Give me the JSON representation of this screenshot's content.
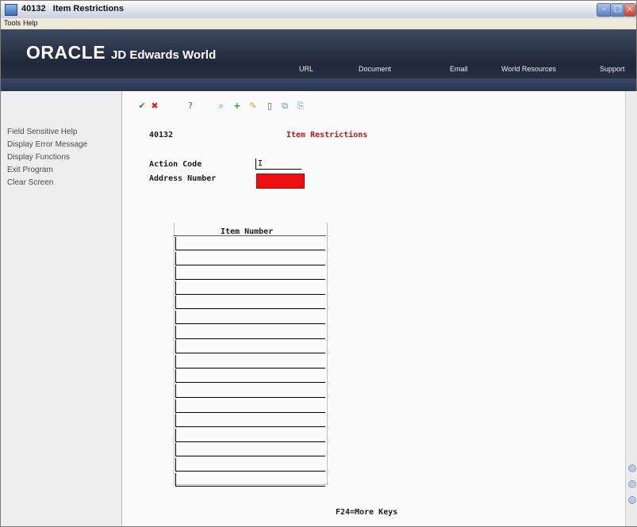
{
  "window": {
    "title": "40132   Item Restrictions",
    "menu": [
      "Tools",
      "Help"
    ]
  },
  "banner": {
    "brand": "ORACLE",
    "brand_sub": "JD Edwards World",
    "links": [
      "URL",
      "Document",
      "Email",
      "World Resources",
      "Support"
    ]
  },
  "sidebar": {
    "items": [
      {
        "label": "Field Sensitive Help"
      },
      {
        "label": "Display Error Message"
      },
      {
        "label": "Display Functions"
      },
      {
        "label": "Exit Program"
      },
      {
        "label": "Clear Screen"
      }
    ]
  },
  "toolbar": {
    "icons": [
      "ok-check-icon",
      "cancel-icon",
      "help-question-icon",
      "find-icon",
      "add-icon",
      "edit-pencil-icon",
      "delete-icon",
      "copy-icon",
      "paste-icon"
    ],
    "colors": {
      "ok": "#2f8f2f",
      "cancel": "#c62828",
      "add": "#2f9a2f",
      "edit": "#d7a000"
    }
  },
  "form": {
    "program_id": "40132",
    "title": "Item Restrictions",
    "action_code_label": "Action Code",
    "action_code_value": "I",
    "address_number_label": "Address Number",
    "address_number_value": "",
    "grid": {
      "column_header": "Item Number",
      "rows": [
        "",
        "",
        "",
        "",
        "",
        "",
        "",
        "",
        "",
        "",
        "",
        "",
        "",
        "",
        "",
        "",
        ""
      ]
    },
    "footer": "F24=More Keys"
  },
  "colors": {
    "accent_error": "#ee1010",
    "title_red": "#c41212",
    "banner_dark": "#1f283a"
  }
}
